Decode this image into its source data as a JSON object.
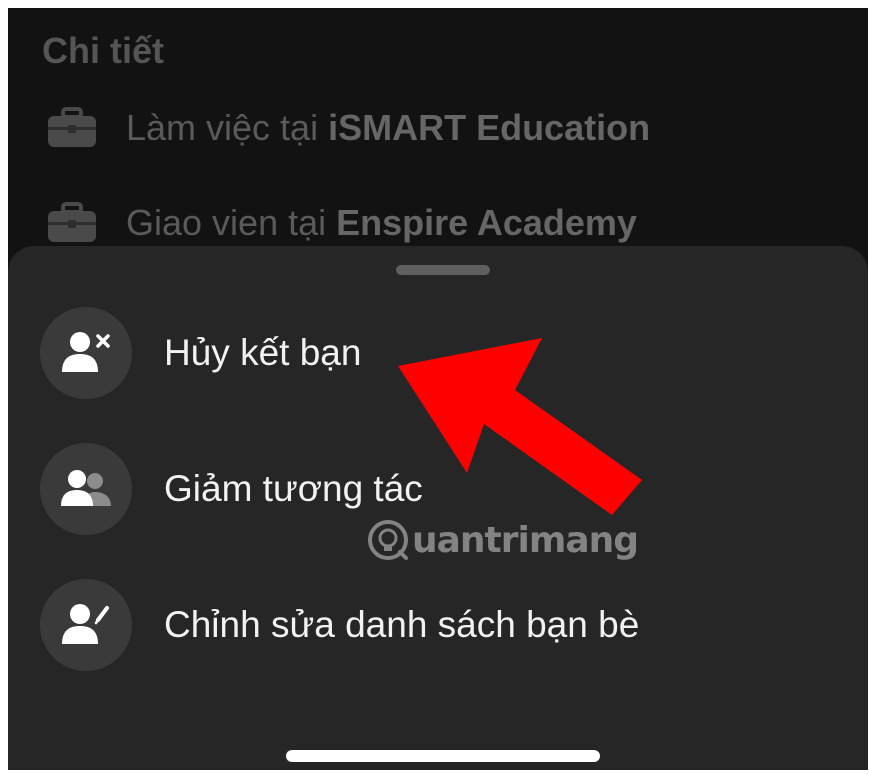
{
  "details": {
    "title": "Chi tiết",
    "rows": [
      {
        "prefix": "Làm việc tại ",
        "bold": "iSMART Education",
        "icon": "briefcase-icon"
      },
      {
        "prefix": "Giao vien tại ",
        "bold": "Enspire Academy",
        "icon": "briefcase-icon"
      }
    ]
  },
  "sheet": {
    "items": [
      {
        "label": "Hủy kết bạn",
        "icon": "unfriend-icon"
      },
      {
        "label": "Giảm tương tác",
        "icon": "friends-icon"
      },
      {
        "label": "Chỉnh sửa danh sách bạn bè",
        "icon": "edit-friend-list-icon"
      }
    ]
  },
  "watermark": {
    "text": "uantrimang"
  },
  "colors": {
    "background": "#121212",
    "sheet": "#262626",
    "icon_circle": "#3a3a3a",
    "annotation_arrow": "#ff0000"
  }
}
